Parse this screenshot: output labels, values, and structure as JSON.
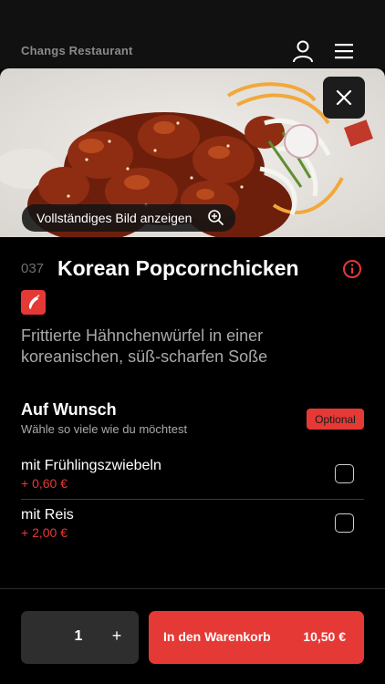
{
  "header": {
    "brand": "Changs Restaurant",
    "user_icon": "user-icon",
    "menu_icon": "hamburger-menu-icon"
  },
  "hero": {
    "full_image_label": "Vollständiges Bild anzeigen",
    "zoom_icon": "zoom-in-icon",
    "close_icon": "close-icon"
  },
  "item": {
    "number": "037",
    "title": "Korean Popcornchicken",
    "info_icon": "info-icon",
    "badge_icon": "chili-spicy-icon",
    "description": "Frittierte Hähnchenwürfel in einer koreanischen, süß-scharfen Soße"
  },
  "options_section": {
    "title": "Auf Wunsch",
    "subtitle": "Wähle so viele wie du möchtest",
    "badge": "Optional",
    "options": [
      {
        "name": "mit Frühlingszwiebeln",
        "price": "+ 0,60 €",
        "checked": false
      },
      {
        "name": "mit Reis",
        "price": "+ 2,00 €",
        "checked": false
      }
    ]
  },
  "footer": {
    "quantity": "1",
    "plus": "+",
    "cart_label": "In den Warenkorb",
    "cart_price": "10,50 €"
  },
  "colors": {
    "accent": "#e53935",
    "background": "#000000",
    "muted": "#a9a9a9"
  }
}
